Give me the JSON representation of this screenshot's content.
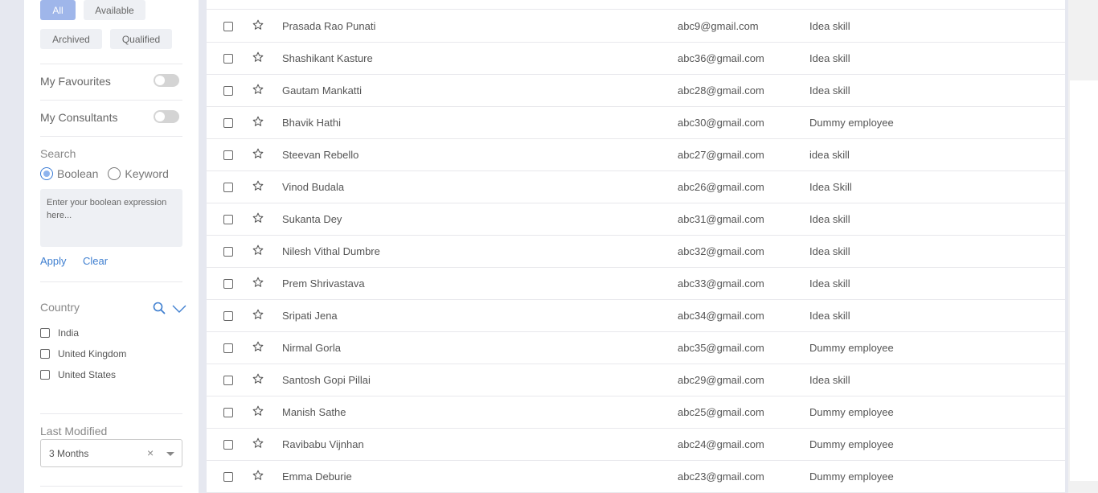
{
  "filters": {
    "status_pills": [
      "All",
      "Available",
      "Archived",
      "Qualified"
    ],
    "active_pill": "All"
  },
  "toggles": {
    "favourites_label": "My Favourites",
    "consultants_label": "My Consultants"
  },
  "search": {
    "title": "Search",
    "radio_boolean": "Boolean",
    "radio_keyword": "Keyword",
    "selected_mode": "Boolean",
    "placeholder": "Enter your boolean expression here...",
    "apply_label": "Apply",
    "clear_label": "Clear"
  },
  "country": {
    "title": "Country",
    "options": [
      "India",
      "United Kingdom",
      "United States"
    ]
  },
  "last_modified": {
    "title": "Last Modified",
    "selected": "3 Months",
    "clear_icon": "×"
  },
  "colors": {
    "accent": "#3f7fd0",
    "active_pill": "#9fb6ea",
    "page_bg": "#e6e8f0"
  },
  "rows": [
    {
      "name": "Prasada Rao Punati",
      "email": "abc9@gmail.com",
      "skill": "Idea skill"
    },
    {
      "name": "Shashikant Kasture",
      "email": "abc36@gmail.com",
      "skill": "Idea skill"
    },
    {
      "name": "Gautam Mankatti",
      "email": "abc28@gmail.com",
      "skill": "Idea skill"
    },
    {
      "name": "Bhavik Hathi",
      "email": "abc30@gmail.com",
      "skill": "Dummy employee"
    },
    {
      "name": "Steevan Rebello",
      "email": "abc27@gmail.com",
      "skill": "idea skill"
    },
    {
      "name": "Vinod Budala",
      "email": "abc26@gmail.com",
      "skill": "Idea Skill"
    },
    {
      "name": "Sukanta Dey",
      "email": "abc31@gmail.com",
      "skill": "Idea skill"
    },
    {
      "name": "Nilesh Vithal Dumbre",
      "email": "abc32@gmail.com",
      "skill": "Idea skill"
    },
    {
      "name": "Prem Shrivastava",
      "email": "abc33@gmail.com",
      "skill": "Idea skill"
    },
    {
      "name": "Sripati Jena",
      "email": "abc34@gmail.com",
      "skill": "Idea skill"
    },
    {
      "name": "Nirmal Gorla",
      "email": "abc35@gmail.com",
      "skill": "Dummy employee"
    },
    {
      "name": "Santosh Gopi Pillai",
      "email": "abc29@gmail.com",
      "skill": "Idea skill"
    },
    {
      "name": "Manish Sathe",
      "email": "abc25@gmail.com",
      "skill": "Dummy employee"
    },
    {
      "name": "Ravibabu Vijnhan",
      "email": "abc24@gmail.com",
      "skill": "Dummy employee"
    },
    {
      "name": "Emma Deburie",
      "email": "abc23@gmail.com",
      "skill": "Dummy employee"
    }
  ]
}
